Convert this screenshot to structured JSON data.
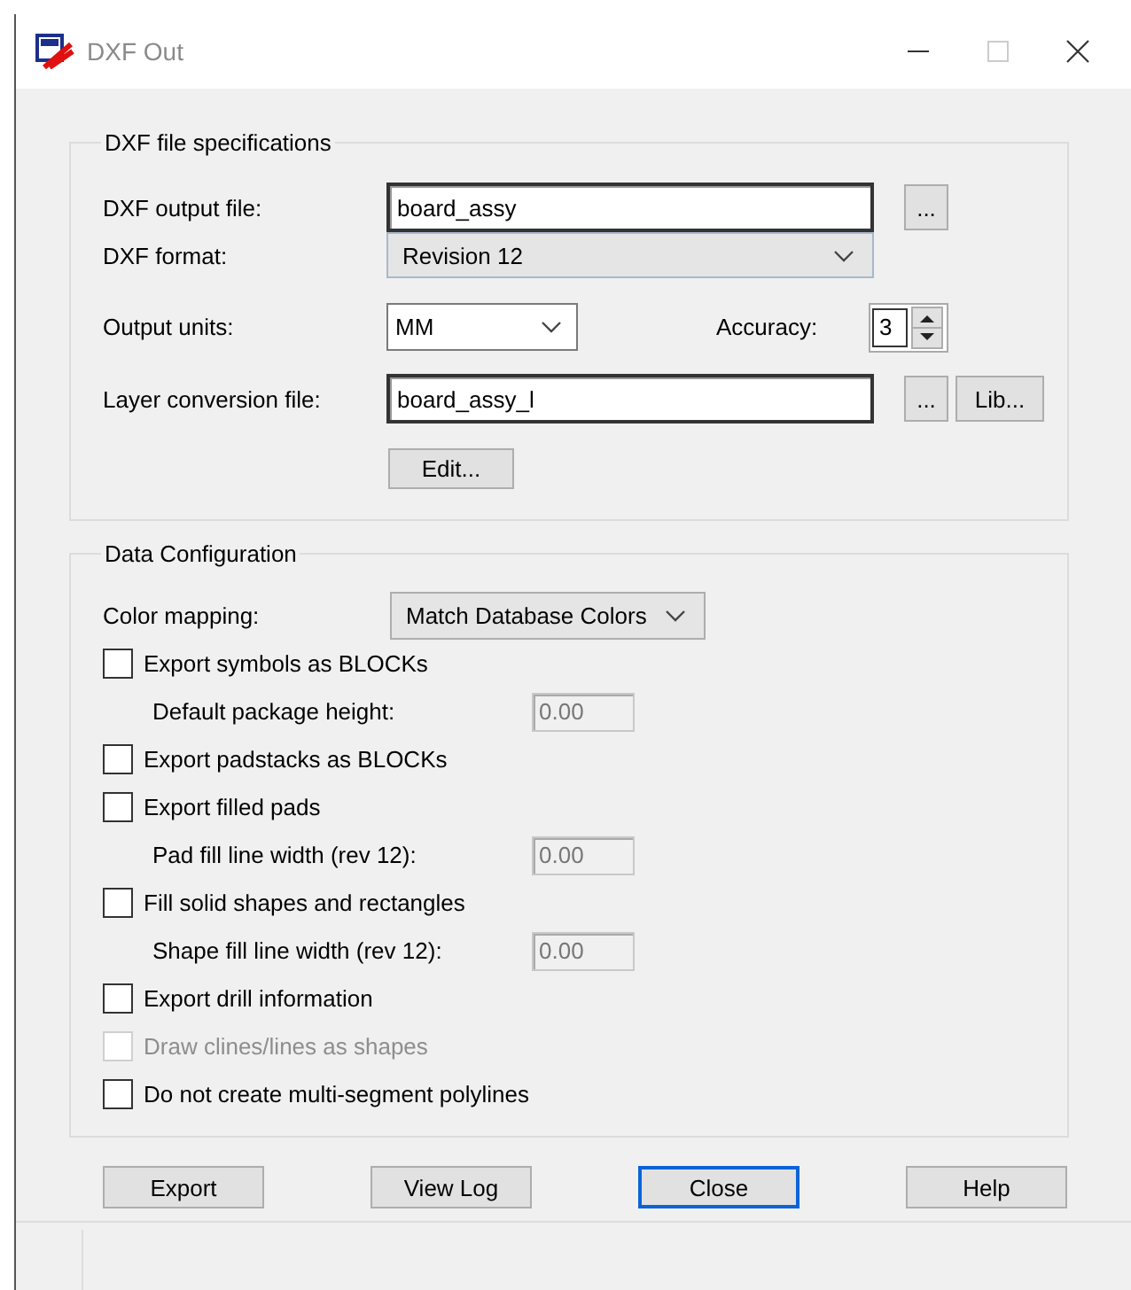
{
  "window": {
    "title": "DXF Out"
  },
  "file_specs": {
    "title": "DXF file specifications",
    "output_file": {
      "label": "DXF output file:",
      "value": "board_assy",
      "browse": "..."
    },
    "format": {
      "label": "DXF format:",
      "value": "Revision 12"
    },
    "units": {
      "label": "Output units:",
      "value": "MM"
    },
    "accuracy": {
      "label": "Accuracy:",
      "value": "3"
    },
    "layer_file": {
      "label": "Layer conversion file:",
      "value": "board_assy_l",
      "browse": "...",
      "library": "Lib..."
    },
    "edit": "Edit..."
  },
  "data_config": {
    "title": "Data Configuration",
    "color_mapping": {
      "label": "Color mapping:",
      "value": "Match Database Colors"
    },
    "options": [
      {
        "kind": "checkbox",
        "label": "Export symbols as BLOCKs",
        "checked": false,
        "disabled": false
      },
      {
        "kind": "field",
        "label": "Default package height:",
        "value": "0.00",
        "disabled": true
      },
      {
        "kind": "checkbox",
        "label": "Export padstacks as BLOCKs",
        "checked": false,
        "disabled": false
      },
      {
        "kind": "checkbox",
        "label": "Export filled pads",
        "checked": false,
        "disabled": false
      },
      {
        "kind": "field",
        "label": "Pad fill line width (rev 12):",
        "value": "0.00",
        "disabled": true
      },
      {
        "kind": "checkbox",
        "label": "Fill solid shapes and rectangles",
        "checked": false,
        "disabled": false
      },
      {
        "kind": "field",
        "label": "Shape fill line width (rev 12):",
        "value": "0.00",
        "disabled": true
      },
      {
        "kind": "checkbox",
        "label": "Export drill information",
        "checked": false,
        "disabled": false
      },
      {
        "kind": "checkbox",
        "label": "Draw clines/lines as shapes",
        "checked": false,
        "disabled": true
      },
      {
        "kind": "checkbox",
        "label": "Do not create multi-segment polylines",
        "checked": false,
        "disabled": false
      }
    ]
  },
  "buttons": [
    {
      "label": "Export",
      "focused": false
    },
    {
      "label": "View Log",
      "focused": false
    },
    {
      "label": "Close",
      "focused": true
    },
    {
      "label": "Help",
      "focused": false
    }
  ]
}
